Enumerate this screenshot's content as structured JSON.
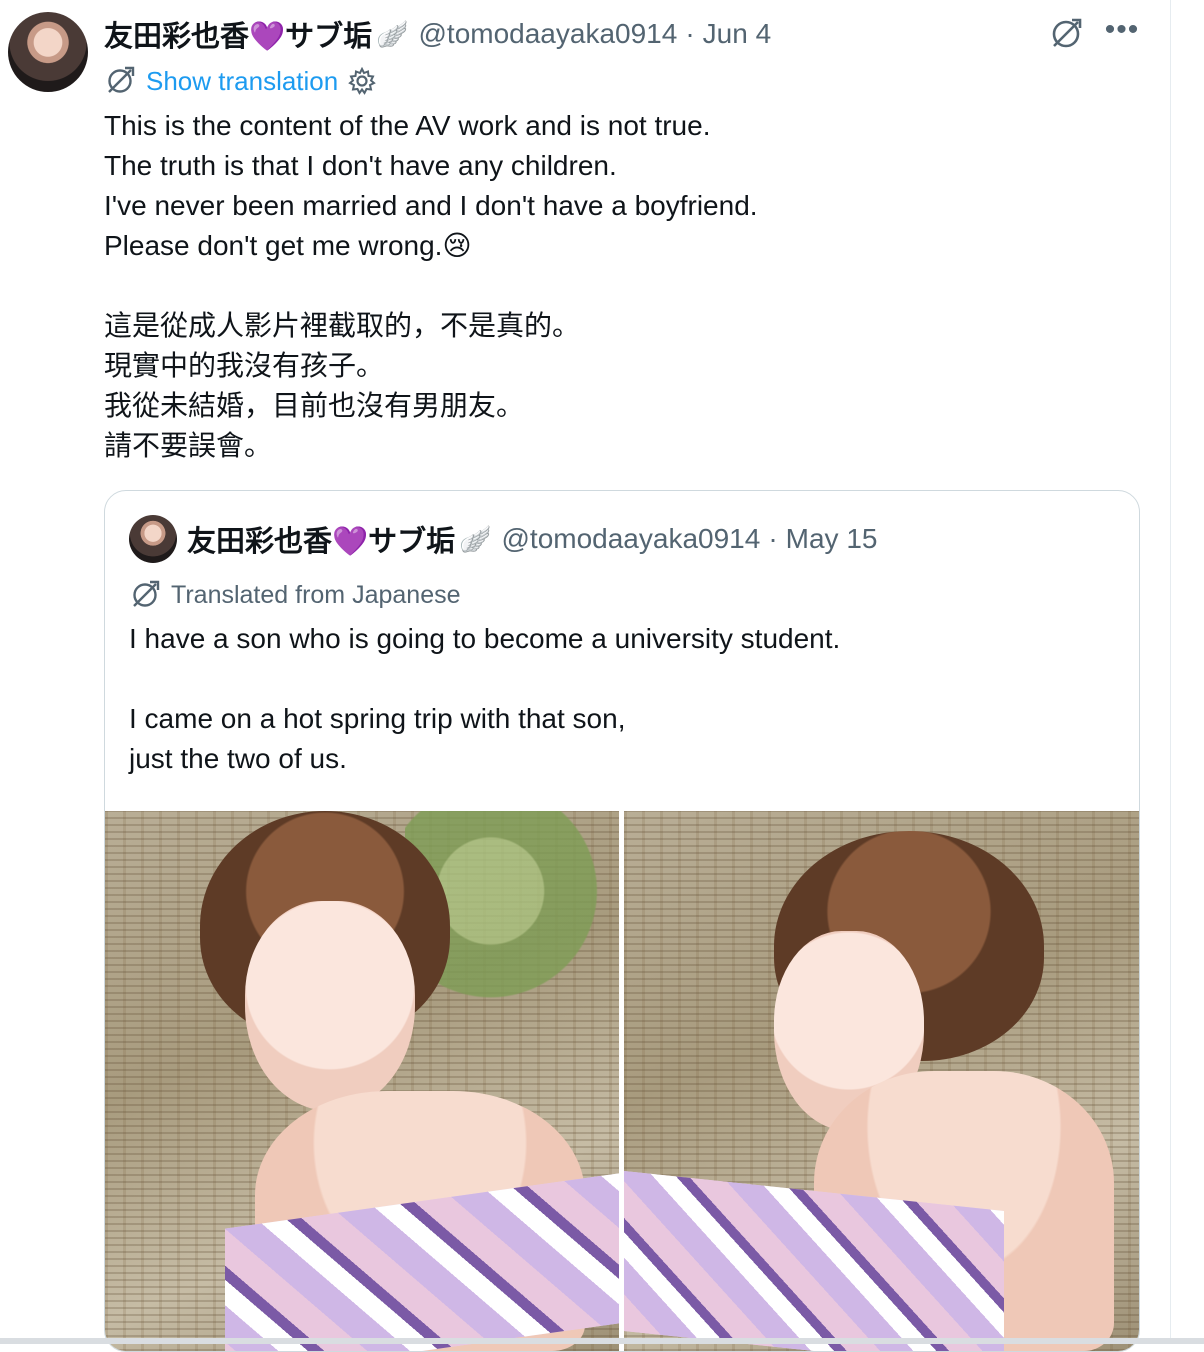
{
  "tweet": {
    "author": {
      "display_name": "友田彩也香💜サブ垢",
      "name_emoji": "🪽",
      "handle": "@tomodaayaka0914",
      "separator": "·",
      "date": "Jun 4"
    },
    "show_translation": "Show translation",
    "more_label": "•••",
    "body_lines": [
      "This is the content of the AV work and is not true.",
      "The truth is that I don't have any children.",
      "I've never been married and I don't have a boyfriend.",
      "Please don't get me wrong.😢",
      "",
      "這是從成人影片裡截取的，不是真的。",
      "現實中的我沒有孩子。",
      "我從未結婚，目前也沒有男朋友。",
      "請不要誤會。"
    ]
  },
  "quote": {
    "author": {
      "display_name": "友田彩也香💜サブ垢",
      "name_emoji": "🪽",
      "handle": "@tomodaayaka0914",
      "separator": "·",
      "date": "May 15"
    },
    "translated_label": "Translated from Japanese",
    "body_lines": [
      "I have a son who is going to become a university student.",
      "",
      "I came on a hot spring trip with that son,",
      "just the two of us."
    ]
  },
  "colors": {
    "link": "#1d9bf0",
    "secondary_text": "#536471",
    "primary_text": "#0f1419",
    "border": "#cfd9de"
  },
  "icons": [
    "translate-globe-icon",
    "more-icon",
    "settings-gear-icon"
  ]
}
